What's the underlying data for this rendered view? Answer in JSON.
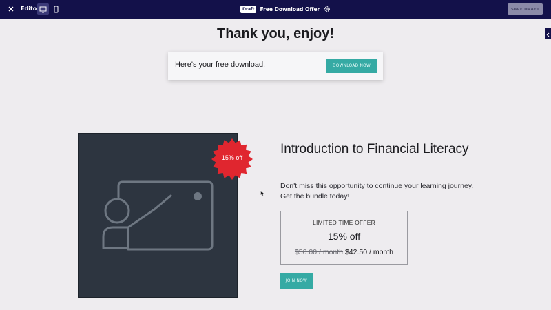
{
  "topbar": {
    "editor_label": "Editor",
    "draft_badge": "Draft",
    "page_title": "Free Download Offer",
    "save_label": "SAVE DRAFT"
  },
  "icons": {
    "close": "close-icon",
    "desktop": "desktop-icon",
    "mobile": "mobile-icon",
    "settings": "gear-icon",
    "sidebar_toggle": "chevron-left-icon",
    "product_image": "presentation-icon"
  },
  "main": {
    "headline": "Thank you, enjoy!",
    "download_text": "Here's your free download.",
    "download_button": "DOWNLOAD NOW"
  },
  "product": {
    "badge": "15% off",
    "title": "Introduction to Financial Literacy",
    "description": "Don't miss this opportunity to continue your learning journey. Get the bundle today!",
    "offer_label": "LIMITED TIME OFFER",
    "offer_percent": "15% off",
    "old_price": "$50.00 / month",
    "new_price": "$42.50 / month",
    "join_button": "JOIN NOW"
  },
  "colors": {
    "topbar": "#13114a",
    "accent": "#35aaa4",
    "seal": "#e0262f",
    "image_bg": "#2d3540"
  }
}
